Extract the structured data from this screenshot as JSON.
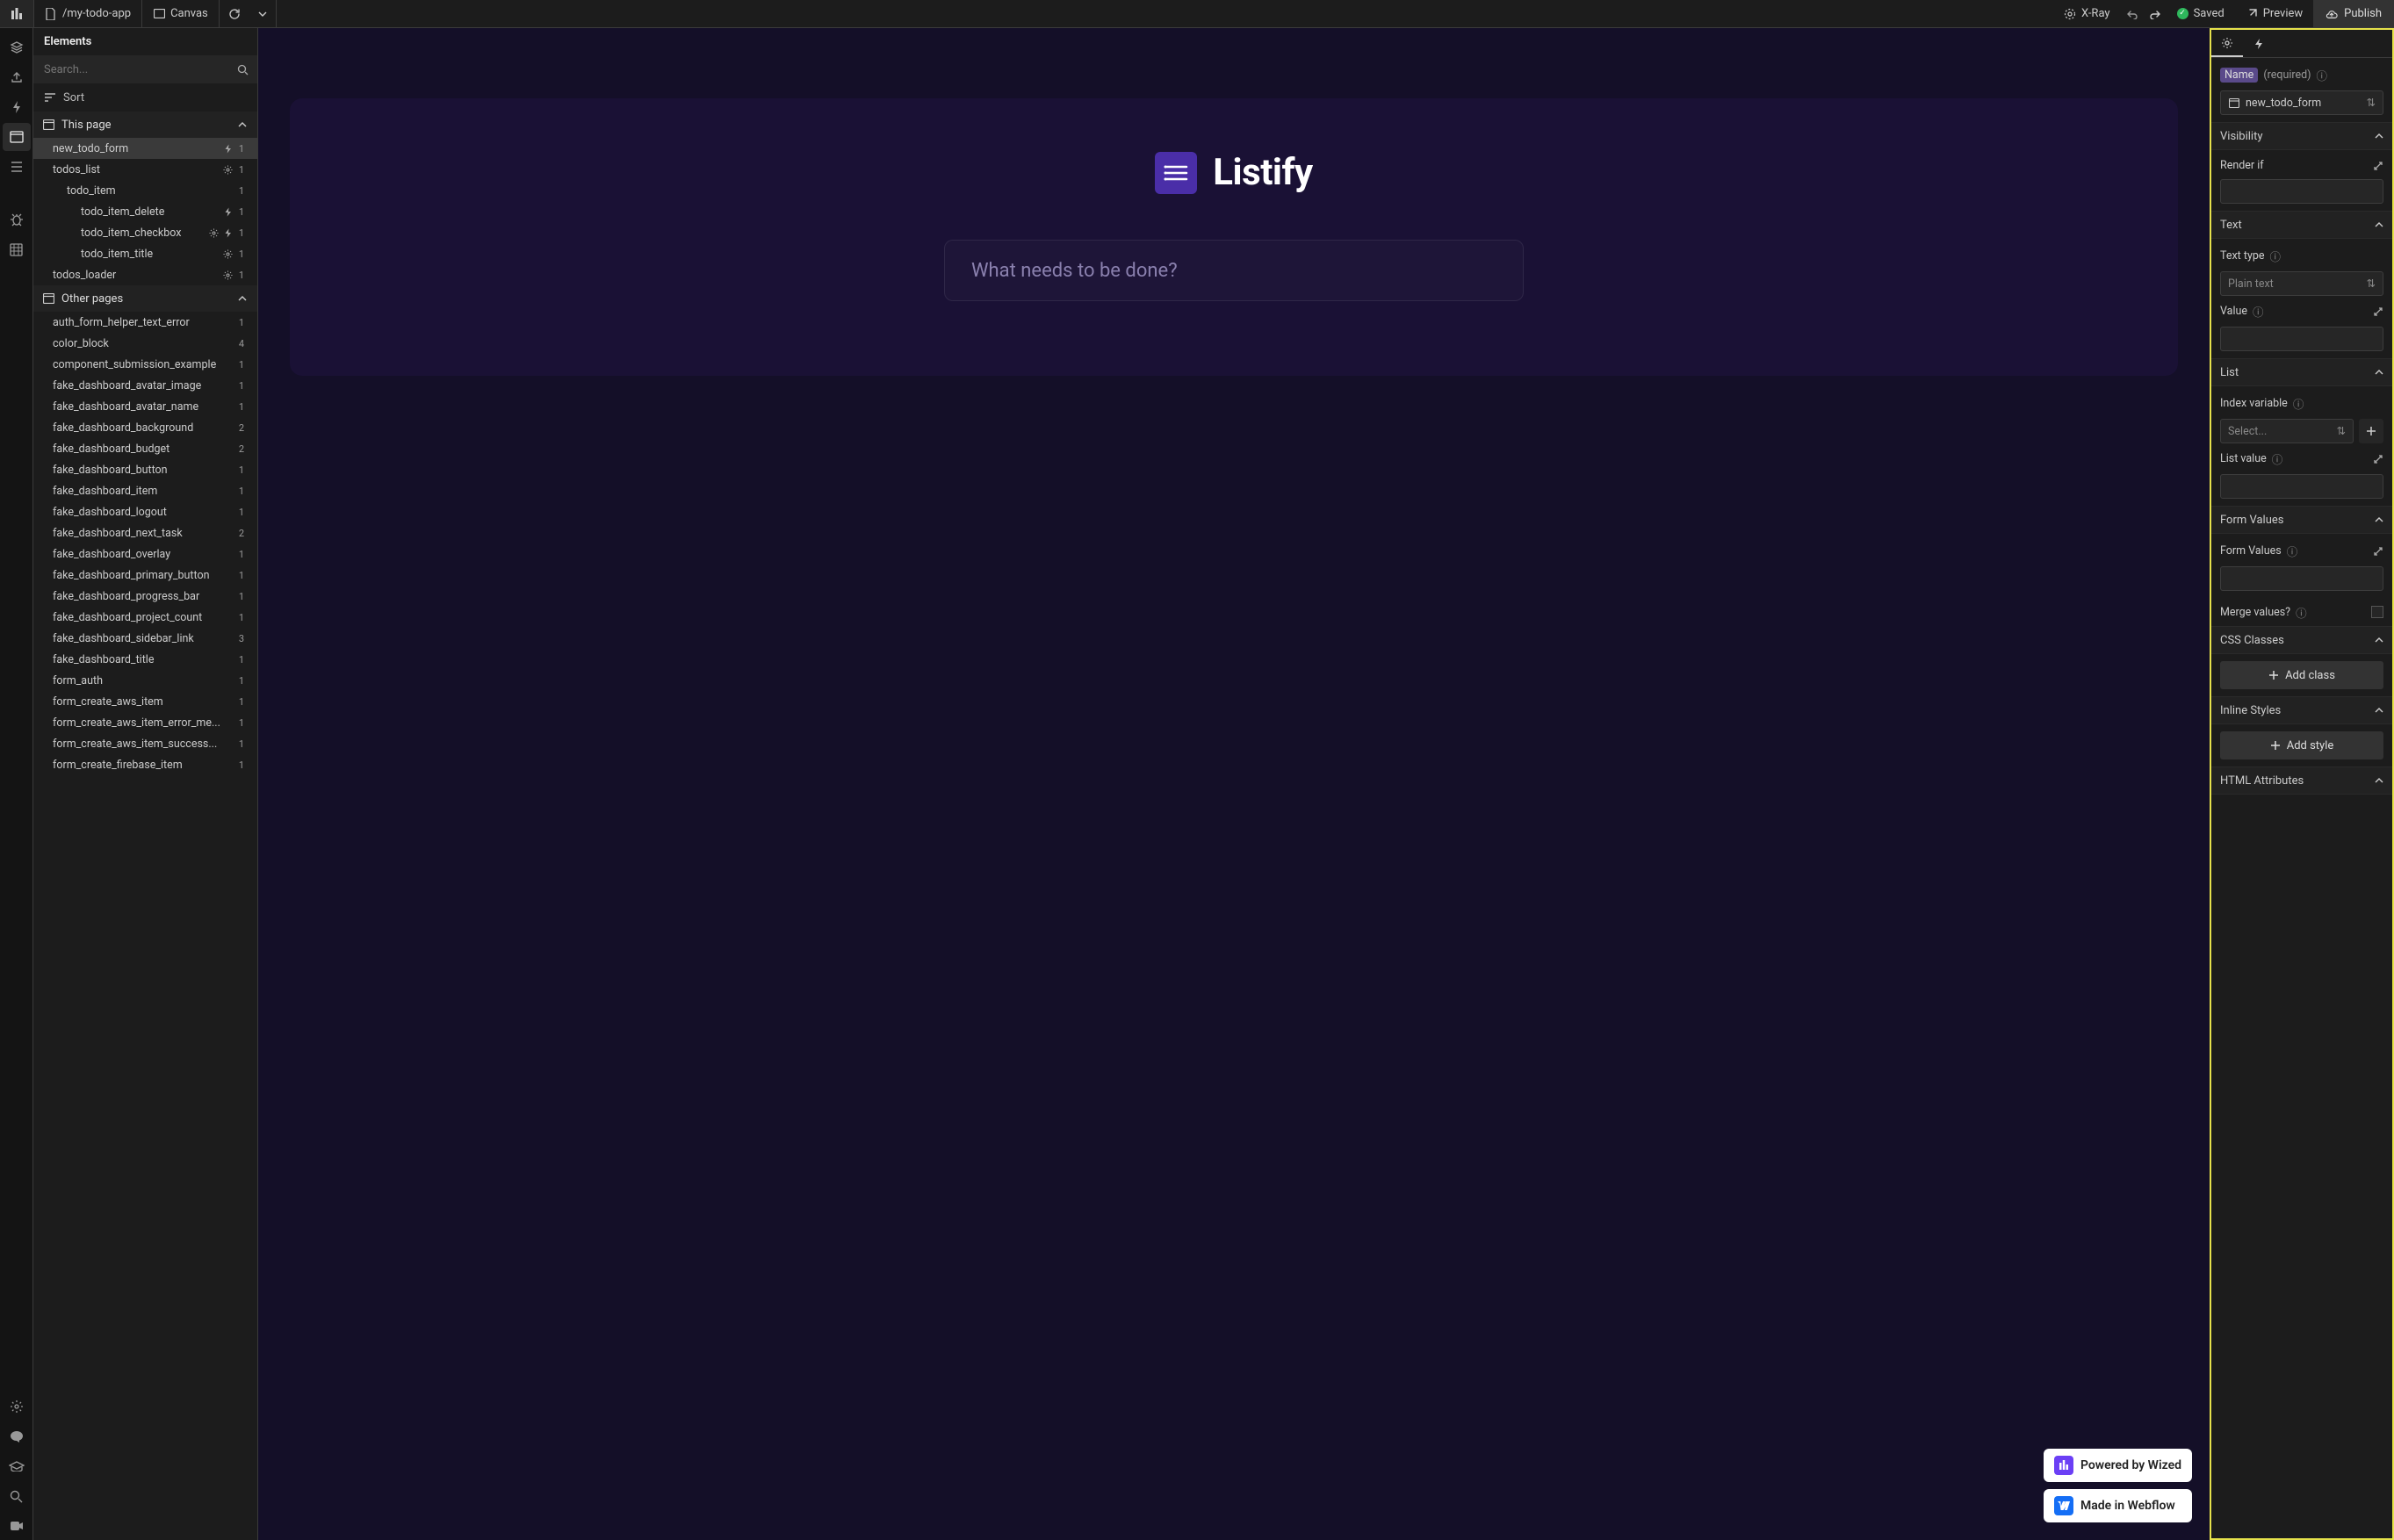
{
  "topbar": {
    "file_path": "/my-todo-app",
    "canvas": "Canvas",
    "xray": "X-Ray",
    "saved": "Saved",
    "preview": "Preview",
    "publish": "Publish"
  },
  "sidebar": {
    "title": "Elements",
    "search_placeholder": "Search...",
    "sort": "Sort",
    "this_page_header": "This page",
    "this_page_items": [
      {
        "label": "new_todo_form",
        "indent": 1,
        "selected": true,
        "icons": [
          "bolt"
        ],
        "count": "1"
      },
      {
        "label": "todos_list",
        "indent": 1,
        "icons": [
          "gear"
        ],
        "count": "1"
      },
      {
        "label": "todo_item",
        "indent": 2,
        "icons": [],
        "count": "1"
      },
      {
        "label": "todo_item_delete",
        "indent": 3,
        "icons": [
          "bolt"
        ],
        "count": "1"
      },
      {
        "label": "todo_item_checkbox",
        "indent": 3,
        "icons": [
          "gear",
          "bolt"
        ],
        "count": "1"
      },
      {
        "label": "todo_item_title",
        "indent": 3,
        "icons": [
          "gear"
        ],
        "count": "1"
      },
      {
        "label": "todos_loader",
        "indent": 1,
        "icons": [
          "gear"
        ],
        "count": "1"
      }
    ],
    "other_pages_header": "Other pages",
    "other_pages_items": [
      {
        "label": "auth_form_helper_text_error",
        "count": "1"
      },
      {
        "label": "color_block",
        "count": "4"
      },
      {
        "label": "component_submission_example",
        "count": "1"
      },
      {
        "label": "fake_dashboard_avatar_image",
        "count": "1"
      },
      {
        "label": "fake_dashboard_avatar_name",
        "count": "1"
      },
      {
        "label": "fake_dashboard_background",
        "count": "2"
      },
      {
        "label": "fake_dashboard_budget",
        "count": "2"
      },
      {
        "label": "fake_dashboard_button",
        "count": "1"
      },
      {
        "label": "fake_dashboard_item",
        "count": "1"
      },
      {
        "label": "fake_dashboard_logout",
        "count": "1"
      },
      {
        "label": "fake_dashboard_next_task",
        "count": "2"
      },
      {
        "label": "fake_dashboard_overlay",
        "count": "1"
      },
      {
        "label": "fake_dashboard_primary_button",
        "count": "1"
      },
      {
        "label": "fake_dashboard_progress_bar",
        "count": "1"
      },
      {
        "label": "fake_dashboard_project_count",
        "count": "1"
      },
      {
        "label": "fake_dashboard_sidebar_link",
        "count": "3"
      },
      {
        "label": "fake_dashboard_title",
        "count": "1"
      },
      {
        "label": "form_auth",
        "count": "1"
      },
      {
        "label": "form_create_aws_item",
        "count": "1"
      },
      {
        "label": "form_create_aws_item_error_me...",
        "count": "1"
      },
      {
        "label": "form_create_aws_item_success...",
        "count": "1"
      },
      {
        "label": "form_create_firebase_item",
        "count": "1"
      }
    ]
  },
  "canvas": {
    "brand": "Listify",
    "input_placeholder": "What needs to be done?",
    "badge_wized": "Powered by Wized",
    "badge_webflow": "Made in Webflow"
  },
  "rightpanel": {
    "name_label": "Name",
    "name_required": "(required)",
    "name_value": "new_todo_form",
    "sections": {
      "visibility": {
        "title": "Visibility",
        "render_if": "Render if"
      },
      "text": {
        "title": "Text",
        "text_type": "Text type",
        "text_type_value": "Plain text",
        "value": "Value"
      },
      "list": {
        "title": "List",
        "index_var": "Index variable",
        "index_ph": "Select...",
        "list_value": "List value"
      },
      "form_values": {
        "title": "Form Values",
        "label": "Form Values",
        "merge": "Merge values?"
      },
      "css": {
        "title": "CSS Classes",
        "add": "Add class"
      },
      "inline": {
        "title": "Inline Styles",
        "add": "Add style"
      },
      "html_attrs": {
        "title": "HTML Attributes"
      }
    }
  }
}
